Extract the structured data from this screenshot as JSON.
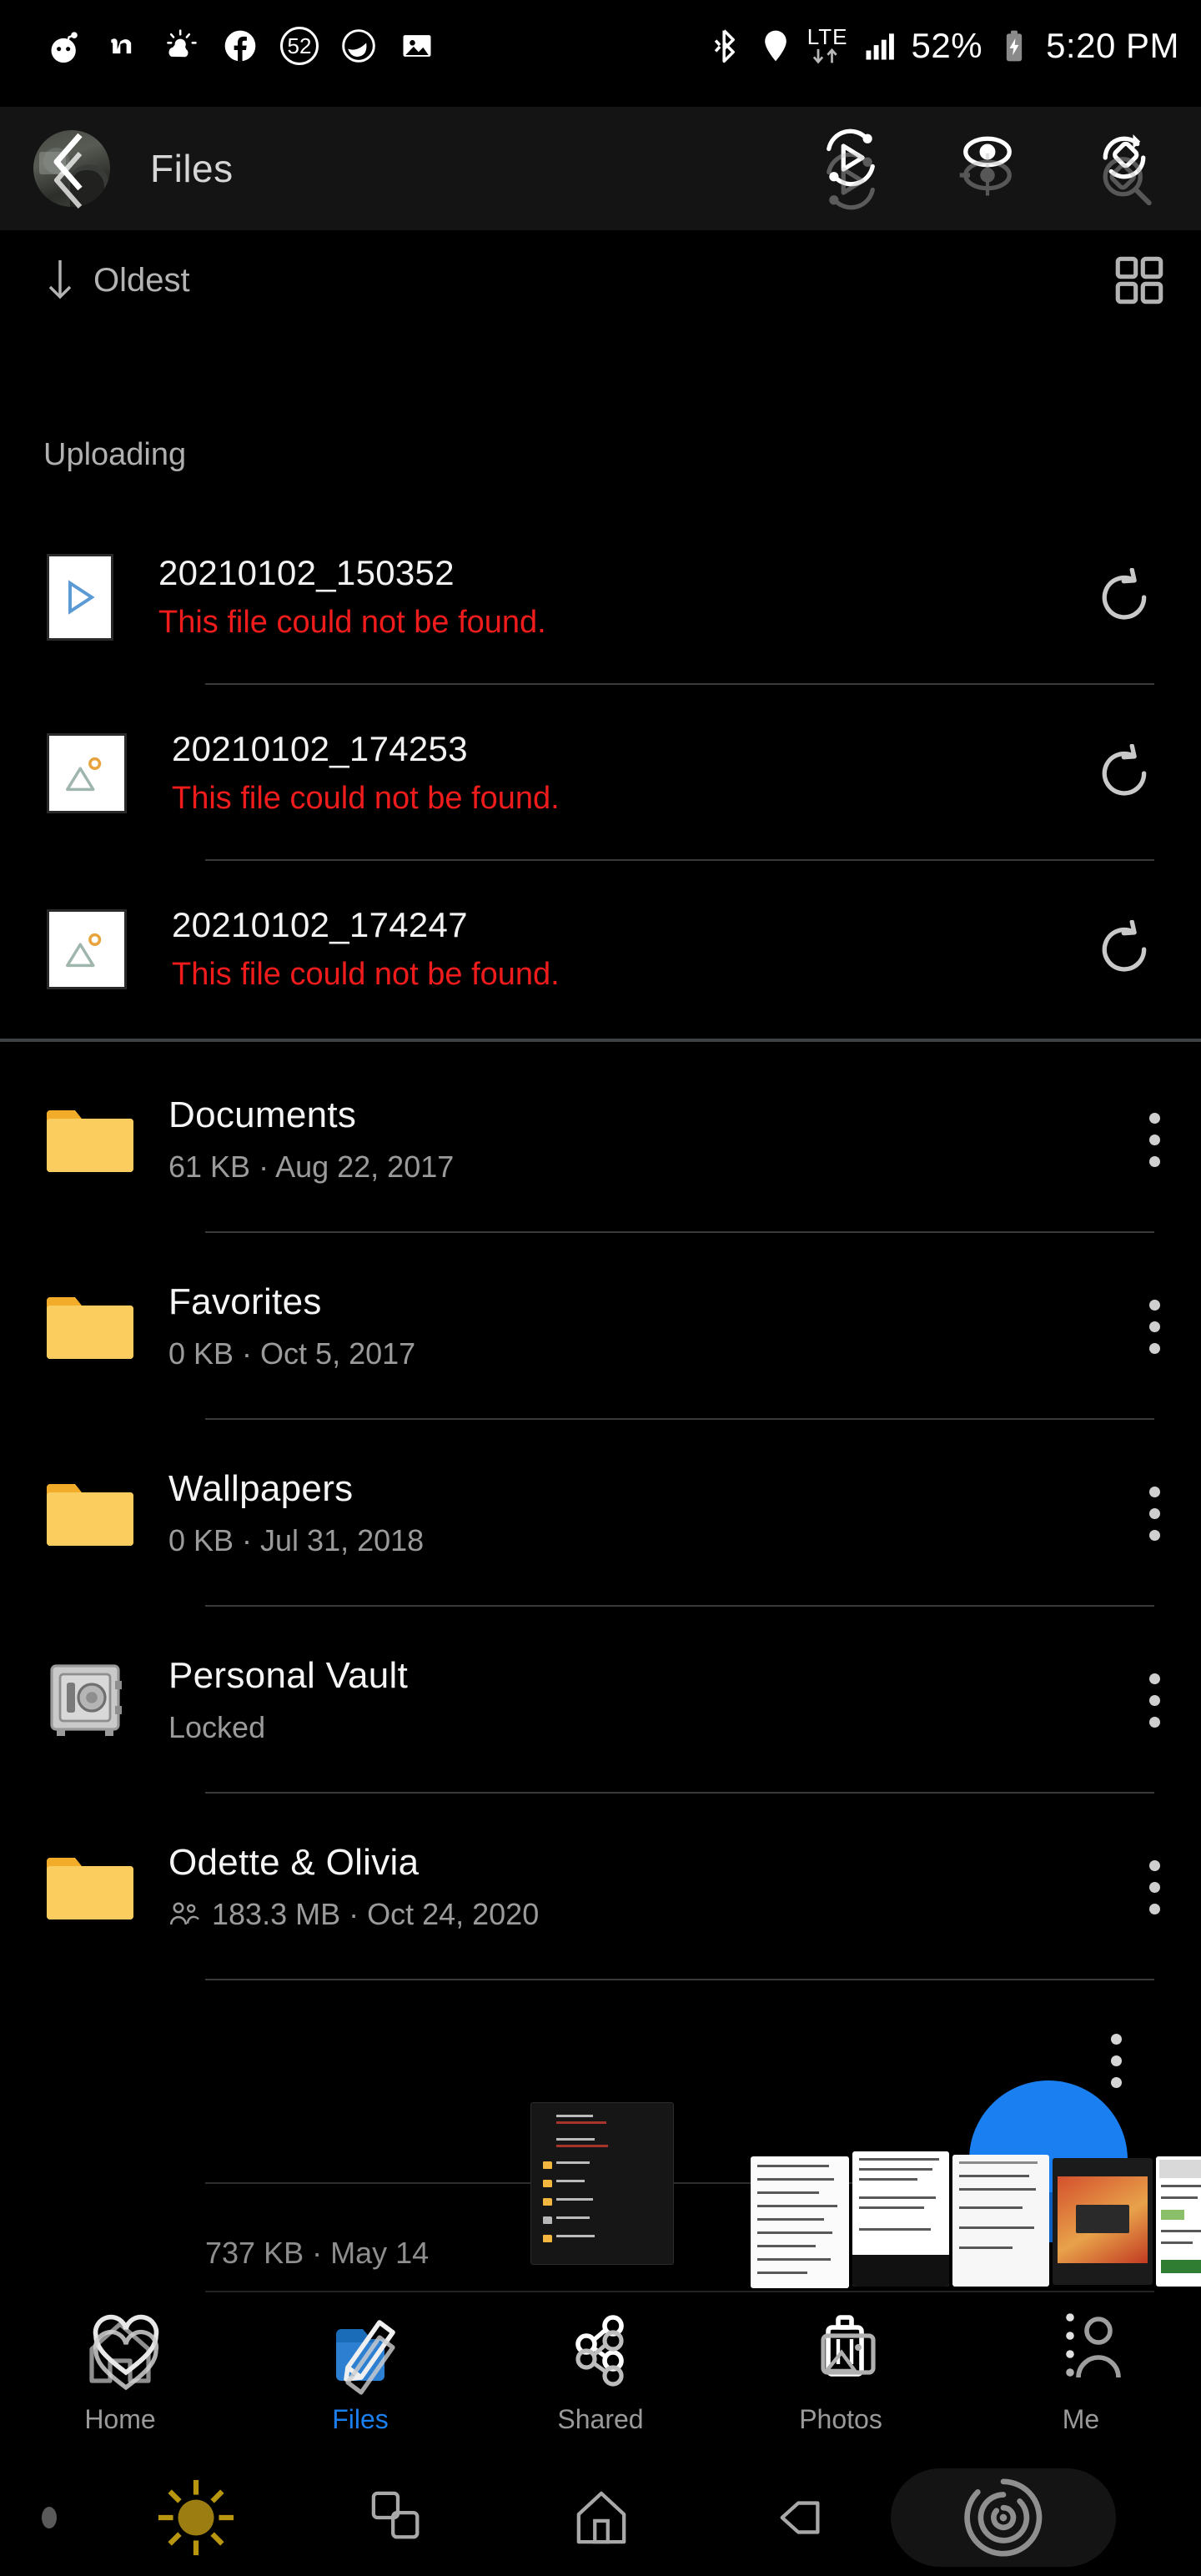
{
  "status_bar": {
    "left_icons": [
      {
        "name": "reddit-icon"
      },
      {
        "name": "nextdoor-icon"
      },
      {
        "name": "weather-icon"
      },
      {
        "name": "facebook-icon"
      },
      {
        "name": "notification-count-icon",
        "value": "52"
      },
      {
        "name": "leaf-app-icon"
      },
      {
        "name": "gallery-icon"
      }
    ],
    "right_icons": [
      {
        "name": "bluetooth-icon"
      },
      {
        "name": "location-icon"
      },
      {
        "name": "lte-data-icon",
        "label": "LTE"
      },
      {
        "name": "signal-bars-icon"
      }
    ],
    "battery_percent": "52%",
    "battery_charging": true,
    "time": "5:20 PM"
  },
  "app_bar": {
    "title": "Files",
    "back_label": "Back",
    "avatar_label": "Account avatar",
    "actions": [
      {
        "name": "slideshow-button",
        "label": "Slideshow"
      },
      {
        "name": "view-options-button",
        "label": "View"
      },
      {
        "name": "sync-button",
        "label": "Sync"
      }
    ]
  },
  "sort_bar": {
    "sort_label": "Oldest",
    "sort_direction": "descending",
    "view_toggle_label": "Grid view"
  },
  "uploading": {
    "section_title": "Uploading",
    "items": [
      {
        "name": "20210102_150352",
        "error": "This file could not be found.",
        "thumb": "video",
        "retry_label": "Retry"
      },
      {
        "name": "20210102_174253",
        "error": "This file could not be found.",
        "thumb": "photo",
        "retry_label": "Retry"
      },
      {
        "name": "20210102_174247",
        "error": "This file could not be found.",
        "thumb": "photo",
        "retry_label": "Retry"
      }
    ]
  },
  "files": {
    "items": [
      {
        "name": "Documents",
        "meta": "61 KB · Aug 22, 2017",
        "icon": "folder",
        "shared": false,
        "menu_label": "More options"
      },
      {
        "name": "Favorites",
        "meta": "0 KB · Oct 5, 2017",
        "icon": "folder",
        "shared": false,
        "menu_label": "More options"
      },
      {
        "name": "Wallpapers",
        "meta": "0 KB · Jul 31, 2018",
        "icon": "folder",
        "shared": false,
        "menu_label": "More options"
      },
      {
        "name": "Personal Vault",
        "meta": "Locked",
        "icon": "vault",
        "shared": false,
        "menu_label": "More options"
      },
      {
        "name": "Odette & Olivia",
        "meta": "183.3 MB · Oct 24, 2020",
        "icon": "folder",
        "shared": true,
        "menu_label": "More options"
      }
    ],
    "partial_item_meta": "737 KB · May 14"
  },
  "bottom_nav": {
    "items": [
      {
        "label": "Home",
        "icon": "home-icon",
        "active": false
      },
      {
        "label": "Files",
        "icon": "files-icon",
        "active": true
      },
      {
        "label": "Shared",
        "icon": "shared-icon",
        "active": false
      },
      {
        "label": "Photos",
        "icon": "photos-icon",
        "active": false
      },
      {
        "label": "Me",
        "icon": "me-icon",
        "active": false
      }
    ],
    "active_color": "#1a7ff0"
  },
  "system_nav": {
    "items": [
      {
        "name": "brightness-icon",
        "label": "Brightness"
      },
      {
        "name": "recents-icon",
        "label": "Recents"
      },
      {
        "name": "home-icon",
        "label": "Home"
      },
      {
        "name": "back-icon",
        "label": "Back"
      },
      {
        "name": "assistant-icon",
        "label": "Assistant"
      }
    ]
  },
  "colors": {
    "background": "#000000",
    "appbar": "#141414",
    "error_red": "#f01c1c",
    "folder_yellow": "#f7c04a",
    "accent_blue": "#1a7ff0",
    "secondary_text": "#9b9b9b"
  }
}
